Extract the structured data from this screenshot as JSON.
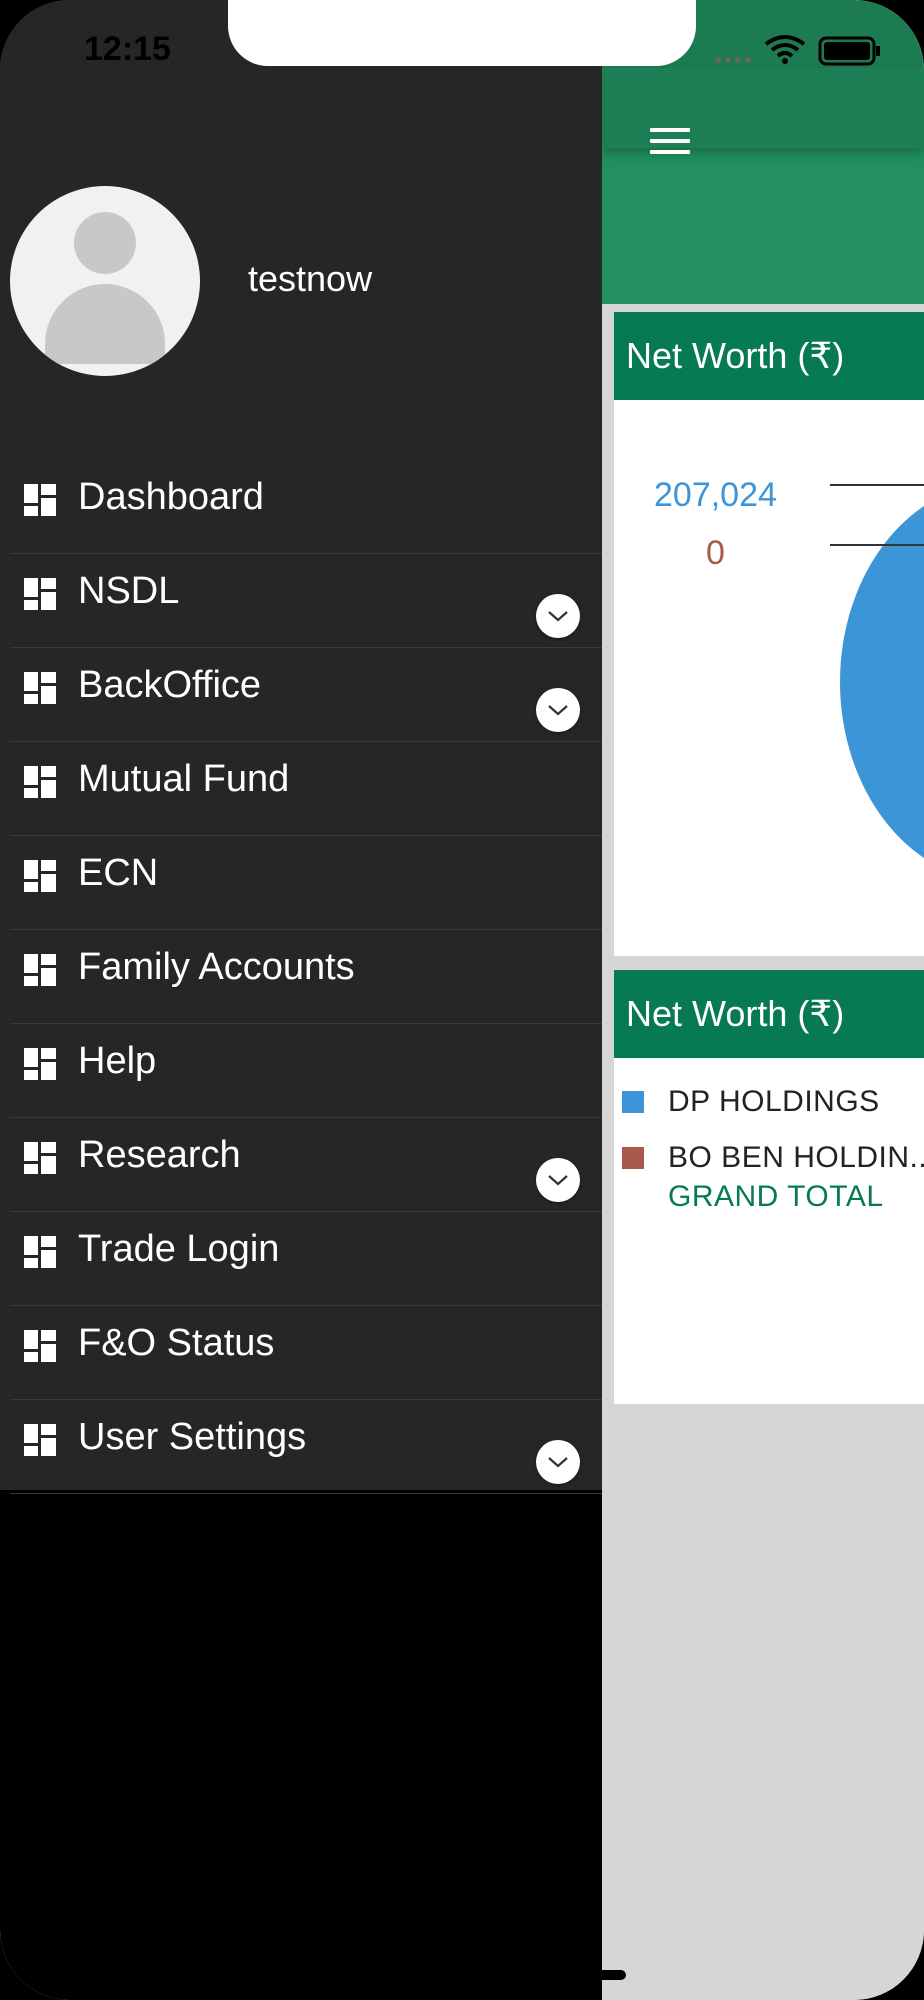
{
  "status_bar": {
    "time": "12:15"
  },
  "drawer": {
    "username": "testnow",
    "items": [
      {
        "label": "Dashboard",
        "has_dropdown": false
      },
      {
        "label": "NSDL",
        "has_dropdown": true
      },
      {
        "label": "BackOffice",
        "has_dropdown": true
      },
      {
        "label": "Mutual Fund",
        "has_dropdown": false
      },
      {
        "label": "ECN",
        "has_dropdown": false
      },
      {
        "label": "Family Accounts",
        "has_dropdown": false
      },
      {
        "label": "Help",
        "has_dropdown": false
      },
      {
        "label": "Research",
        "has_dropdown": true
      },
      {
        "label": "Trade Login",
        "has_dropdown": false
      },
      {
        "label": "F&O Status",
        "has_dropdown": false
      },
      {
        "label": "User Settings",
        "has_dropdown": true
      }
    ]
  },
  "main": {
    "card1": {
      "title": "Net Worth (₹)",
      "value_primary": "207,024",
      "value_secondary": "0"
    },
    "card2": {
      "title": "Net Worth (₹)",
      "legend": [
        {
          "label": "DP HOLDINGS",
          "color": "#3b95d6"
        },
        {
          "label": "BO BEN HOLDIN...",
          "color": "#a9584c"
        }
      ],
      "total_label": "GRAND TOTAL"
    }
  },
  "colors": {
    "header_green": "#1c7f55",
    "card_header_green": "#077a52",
    "drawer_bg": "#262626",
    "series_blue": "#3b95d6",
    "series_red": "#a9584c"
  }
}
